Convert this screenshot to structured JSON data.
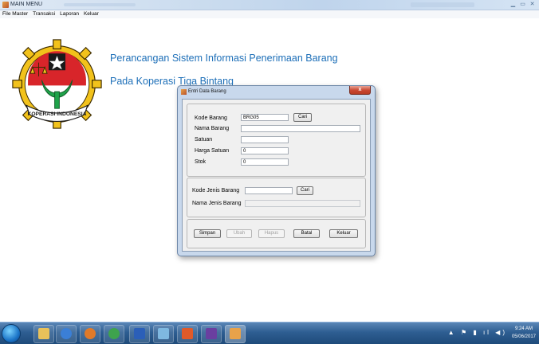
{
  "window": {
    "title": "MAIN MENU"
  },
  "menubar": {
    "items": [
      "File Master",
      "Transaksi",
      "Laporan",
      "Keluar"
    ]
  },
  "logo": {
    "text": "KOPERASI INDONESIA"
  },
  "headings": {
    "line1": "Perancangan Sistem Informasi Penerimaan Barang",
    "line2": "Pada Koperasi Tiga Bintang"
  },
  "dialog": {
    "title": "Entri Data Barang",
    "close_label": "x",
    "group1": {
      "kode_barang_label": "Kode Barang",
      "kode_barang_value": "BRG05",
      "cari_label": "Cari",
      "nama_barang_label": "Nama Barang",
      "nama_barang_value": "",
      "satuan_label": "Satuan",
      "satuan_value": "",
      "harga_satuan_label": "Harga Satuan",
      "harga_satuan_value": "0",
      "stok_label": "Stok",
      "stok_value": "0"
    },
    "group2": {
      "kode_jenis_label": "Kode Jenis Barang",
      "kode_jenis_value": "",
      "cari_label": "Cari",
      "nama_jenis_label": "Nama Jenis Barang",
      "nama_jenis_value": ""
    },
    "buttons": {
      "simpan": "Simpan",
      "ubah": "Ubah",
      "hapus": "Hapus",
      "batal": "Batal",
      "keluar": "Keluar"
    }
  },
  "taskbar": {
    "time": "9:24 AM",
    "date": "05/06/2017"
  },
  "colors": {
    "heading": "#1d6fb8",
    "taskbar": "#2e5e92"
  }
}
